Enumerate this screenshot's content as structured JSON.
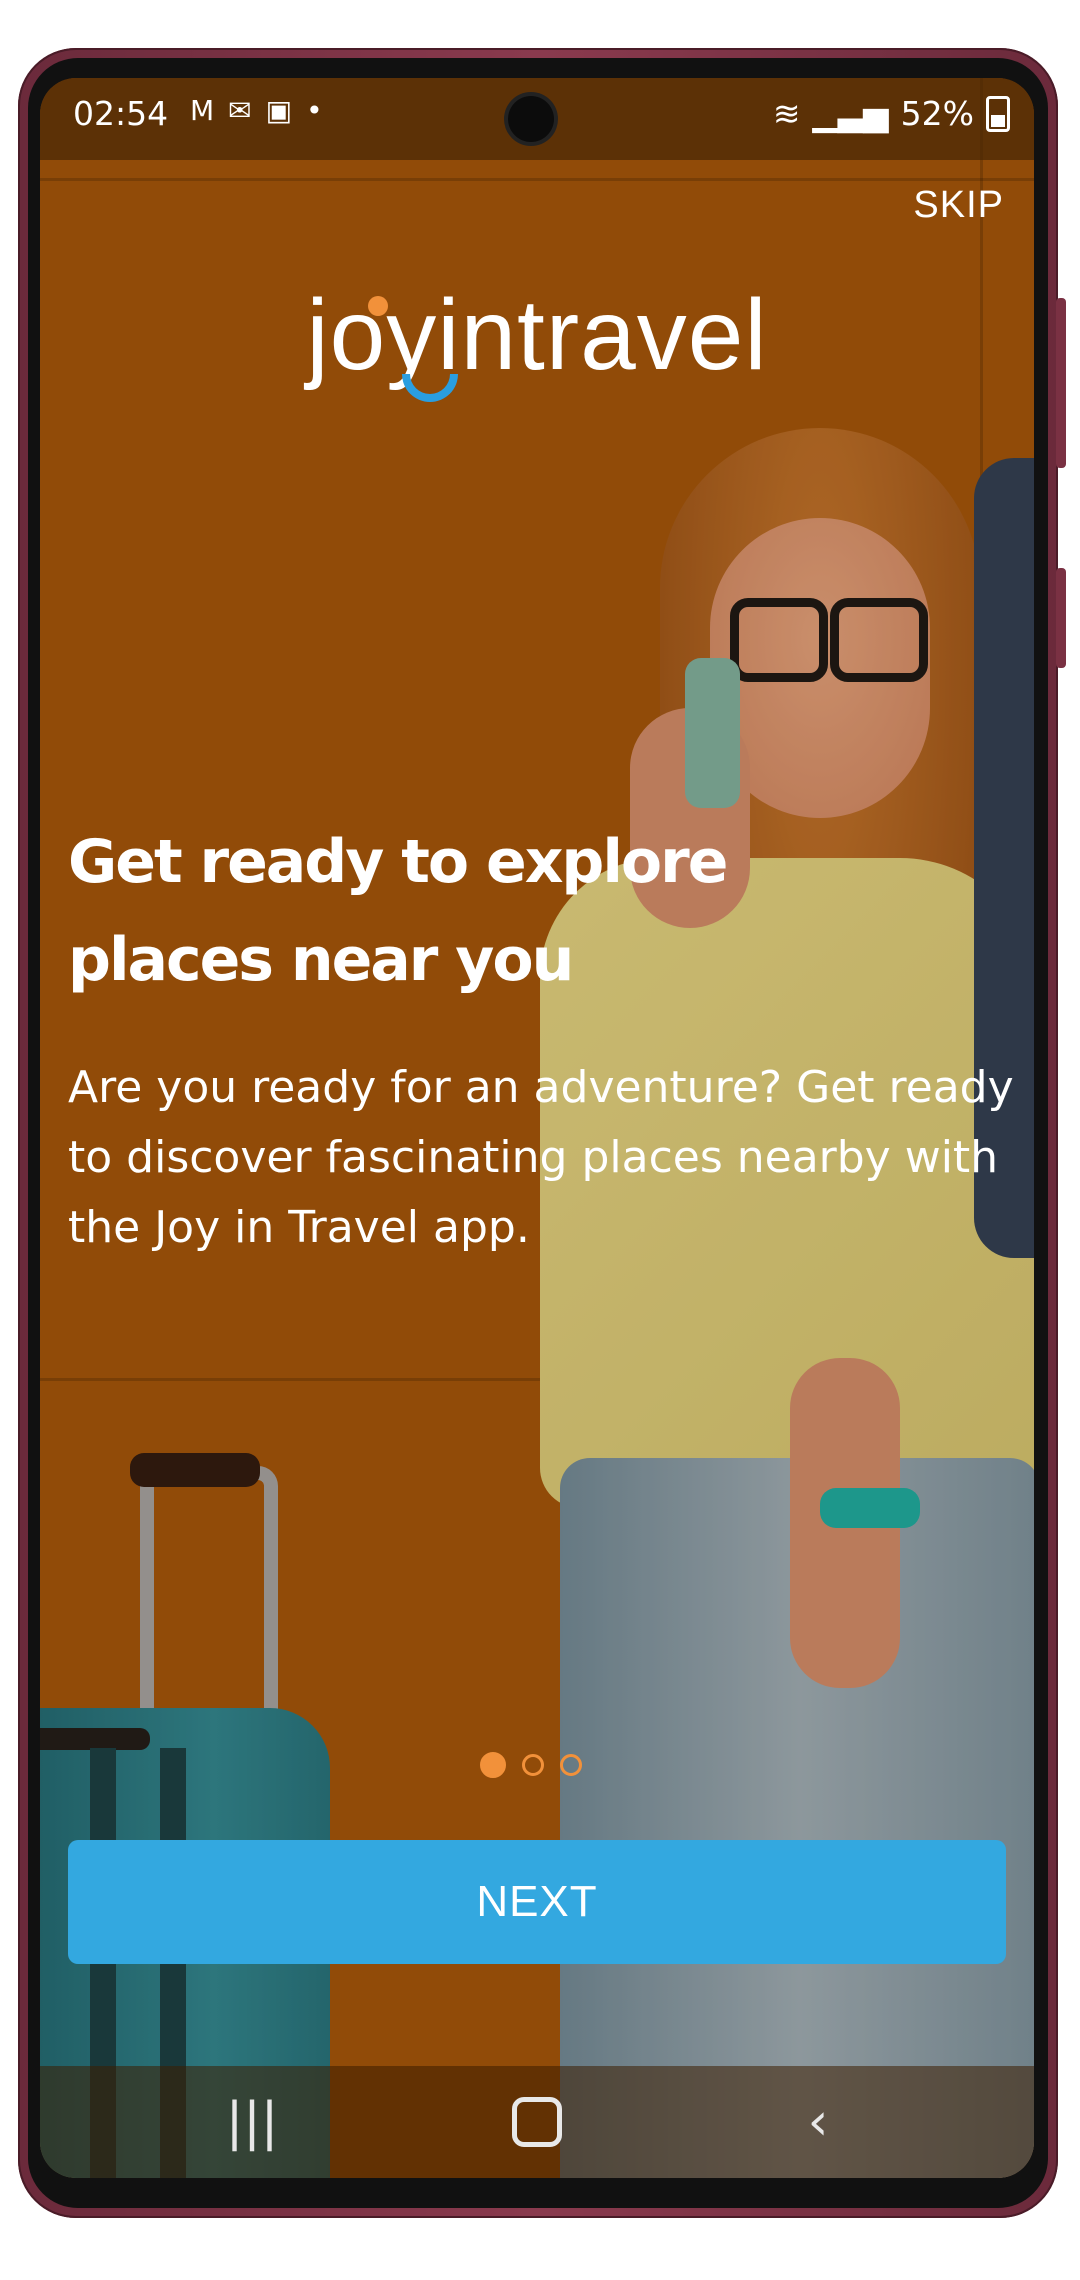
{
  "status_bar": {
    "time": "02:54",
    "notification_icons": [
      "gmail-icon",
      "email-icon",
      "gallery-icon",
      "dot-icon"
    ],
    "battery": "52%"
  },
  "onboarding": {
    "skip_label": "SKIP",
    "logo_text": "joyintravel",
    "headline": "Get ready to explore places near you",
    "description": "Are you ready for an adventure? Get ready to discover fascinating places nearby with the Joy in Travel app.",
    "page_indicator": {
      "current": 1,
      "total": 3
    },
    "next_label": "NEXT"
  },
  "colors": {
    "accent_blue": "#33a8e0",
    "accent_orange": "#f2913a",
    "background": "#a4560a"
  }
}
